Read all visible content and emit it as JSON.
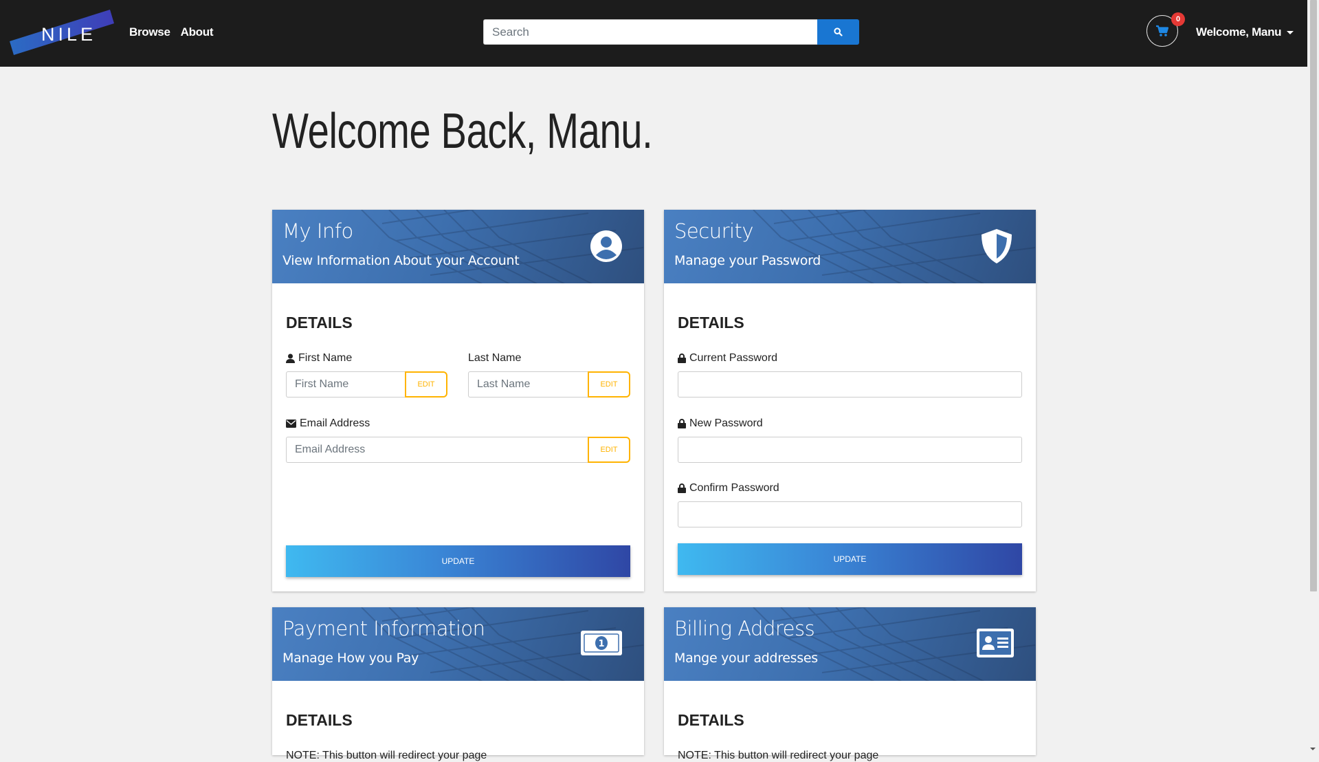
{
  "nav": {
    "logo_text": "NILE",
    "links": [
      "Browse",
      "About"
    ],
    "search_placeholder": "Search",
    "cart_count": "0",
    "user_menu": "Welcome, Manu"
  },
  "page": {
    "welcome": "Welcome Back, Manu."
  },
  "cards": {
    "info": {
      "title": "My Info",
      "subtitle": "View Information About your Account",
      "details": "DETAILS",
      "first_name_label": "First Name",
      "first_name_placeholder": "First Name",
      "last_name_label": "Last Name",
      "last_name_placeholder": "Last Name",
      "email_label": "Email Address",
      "email_placeholder": "Email Address",
      "edit_label": "EDIT",
      "update_label": "UPDATE"
    },
    "security": {
      "title": "Security",
      "subtitle": "Manage your Password",
      "details": "DETAILS",
      "current_label": "Current Password",
      "new_label": "New Password",
      "confirm_label": "Confirm Password",
      "update_label": "UPDATE"
    },
    "payment": {
      "title": "Payment Information",
      "subtitle": "Manage How you Pay",
      "details": "DETAILS",
      "note": "NOTE: This button will redirect your page"
    },
    "billing": {
      "title": "Billing Address",
      "subtitle": "Mange your addresses",
      "details": "DETAILS",
      "note": "NOTE: This button will redirect your page"
    }
  },
  "colors": {
    "navbar": "#1c1c1c",
    "search_button": "#1976d2",
    "edit_accent": "#ffb300",
    "badge": "#e53935"
  }
}
